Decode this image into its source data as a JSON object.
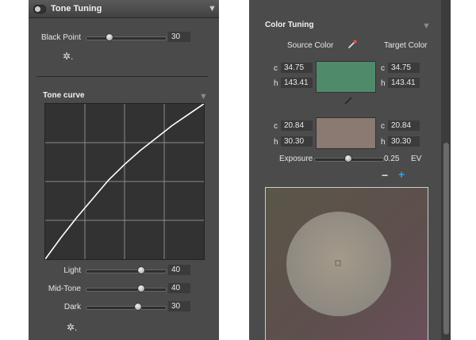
{
  "tone_tuning": {
    "title": "Tone Tuning",
    "black_point": {
      "label": "Black Point",
      "value": "30",
      "level": 0.3
    },
    "tone_curve": {
      "title": "Tone curve",
      "curve": [
        [
          0,
          0
        ],
        [
          0.1,
          0.14
        ],
        [
          0.2,
          0.27
        ],
        [
          0.3,
          0.39
        ],
        [
          0.4,
          0.51
        ],
        [
          0.5,
          0.61
        ],
        [
          0.6,
          0.7
        ],
        [
          0.7,
          0.78
        ],
        [
          0.8,
          0.86
        ],
        [
          0.9,
          0.93
        ],
        [
          1,
          1
        ]
      ]
    },
    "light": {
      "label": "Light",
      "value": "40",
      "level": 0.7
    },
    "mid_tone": {
      "label": "Mid-Tone",
      "value": "40",
      "level": 0.7
    },
    "dark": {
      "label": "Dark",
      "value": "30",
      "level": 0.66
    }
  },
  "color_tuning": {
    "title": "Color Tuning",
    "source_label": "Source Color",
    "target_label": "Target Color",
    "pair1": {
      "source": {
        "c_label": "c",
        "c": "34.75",
        "h_label": "h",
        "h": "143.41"
      },
      "target": {
        "c_label": "c",
        "c": "34.75",
        "h_label": "h",
        "h": "143.41"
      },
      "swatch_color": "#4f8a6b"
    },
    "pair2": {
      "source": {
        "c_label": "c",
        "c": "20.84",
        "h_label": "h",
        "h": "30.30"
      },
      "target": {
        "c_label": "c",
        "c": "20.84",
        "h_label": "h",
        "h": "30.30"
      },
      "swatch_color": "#8a7a72"
    },
    "exposure": {
      "label": "Exposure",
      "value": "0.25",
      "unit": "EV",
      "level": 0.5
    },
    "minus": "−",
    "plus": "+"
  },
  "colors": {
    "panel_bg": "#4a4a4a",
    "accent": "#3aa0e0"
  }
}
